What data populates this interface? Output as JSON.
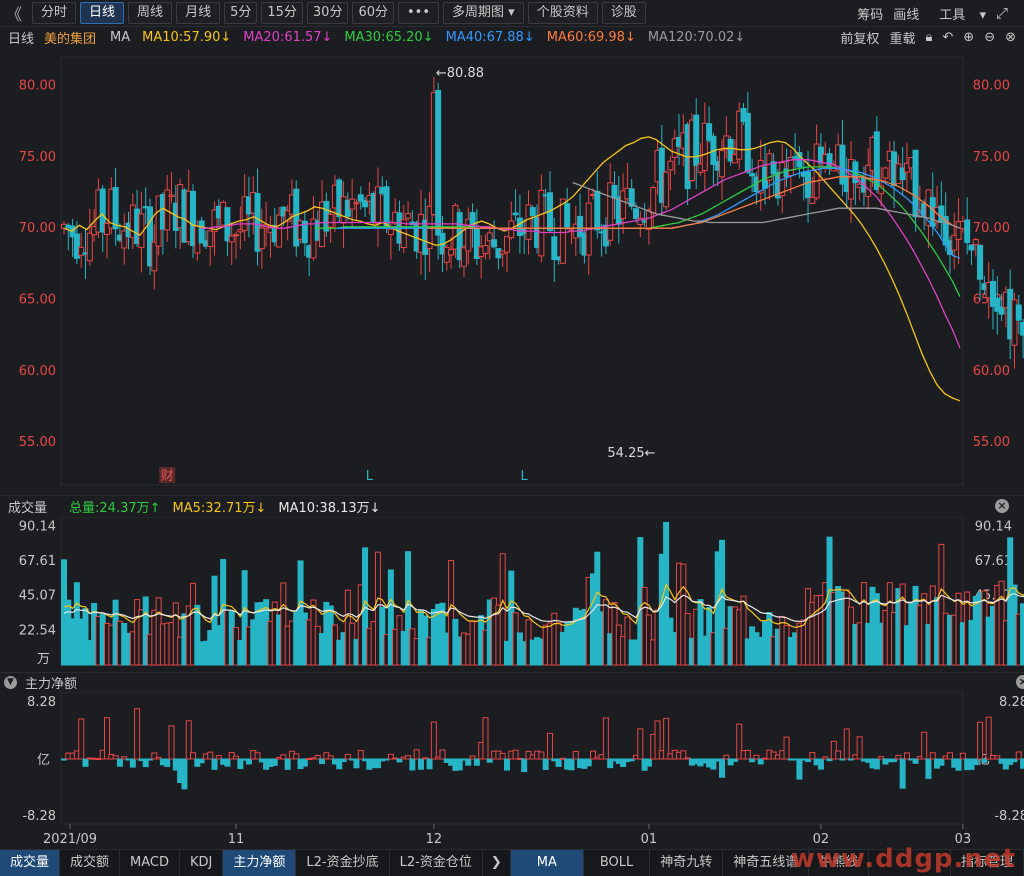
{
  "toolbar": {
    "nav_left": "《",
    "tabs": [
      "分时",
      "日线",
      "周线",
      "月线",
      "5分",
      "15分",
      "30分",
      "60分"
    ],
    "active_tab": "日线",
    "more": "•••",
    "multi_period": "多周期图",
    "stock_info": "个股资料",
    "diagnose": "诊股",
    "right": [
      "筹码",
      "画线",
      "工具"
    ],
    "expand_icon": "expand-icon"
  },
  "ma_bar": {
    "period": "日线",
    "stock": "美的集团",
    "ma_label": "MA",
    "items": [
      {
        "text": "MA10:57.90",
        "arrow": "↓",
        "color": "#f5c518"
      },
      {
        "text": "MA20:61.57",
        "arrow": "↓",
        "color": "#e040c8"
      },
      {
        "text": "MA30:65.20",
        "arrow": "↓",
        "color": "#2ecc40"
      },
      {
        "text": "MA40:67.88",
        "arrow": "↓",
        "color": "#2f9bff"
      },
      {
        "text": "MA60:69.98",
        "arrow": "↓",
        "color": "#ff7b3a"
      },
      {
        "text": "MA120:70.02",
        "arrow": "↓",
        "color": "#9a9a9a"
      }
    ],
    "right": [
      "前复权",
      "重载"
    ]
  },
  "chart_data": [
    {
      "type": "candlestick",
      "name": "price",
      "ylim": [
        52,
        82
      ],
      "yticks": [
        80.0,
        75.0,
        70.0,
        65.0,
        60.0,
        55.0
      ],
      "ytick_labels": [
        "80.00",
        "75.00",
        "70.00",
        "65.00",
        "60.00",
        "55.00"
      ],
      "annotations": [
        {
          "text": "←80.88",
          "value": 80.88,
          "day": 86
        },
        {
          "text": "54.25←",
          "value": 54.25,
          "day": 138
        }
      ],
      "markers": [
        {
          "text": "财",
          "day": 24,
          "color": "#e05050"
        },
        {
          "text": "L",
          "day": 71,
          "color": "#26b5c6"
        },
        {
          "text": "L",
          "day": 107,
          "color": "#26b5c6"
        }
      ],
      "series": [
        {
          "name": "MA10",
          "color": "#f5c518",
          "values": [
            70.0,
            69.8,
            70.2,
            69.9,
            70.5,
            71.0,
            70.4,
            70.2,
            70.1,
            69.8,
            69.5,
            70.2,
            71.0,
            71.4,
            71.1,
            70.8,
            70.6,
            70.2,
            70.1,
            70.0,
            69.9,
            70.1,
            70.3,
            70.5,
            70.6,
            70.8,
            70.5,
            70.2,
            70.1,
            70.4,
            70.8,
            71.0,
            71.2,
            71.5,
            71.4,
            71.2,
            71.0,
            70.8,
            70.6,
            70.5,
            70.3,
            70.2,
            70.4,
            70.1,
            69.8,
            69.6,
            69.4,
            69.2,
            69.0,
            68.8,
            68.9,
            69.2,
            69.6,
            70.0,
            70.3,
            70.5,
            70.3,
            70.0,
            69.8,
            70.0,
            70.3,
            70.6,
            70.8,
            71.0,
            71.2,
            71.5,
            71.8,
            72.2,
            72.8,
            73.4,
            74.0,
            74.6,
            75.0,
            75.4,
            75.8,
            76.0,
            76.3,
            76.4,
            76.2,
            75.8,
            75.4,
            75.2,
            75.0,
            75.0,
            75.1,
            75.3,
            75.5,
            75.6,
            75.6,
            75.5,
            75.5,
            75.6,
            75.8,
            76.0,
            76.1,
            76.0,
            75.6,
            75.0,
            74.5,
            74.0,
            73.4,
            72.8,
            72.2,
            71.6,
            71.0,
            70.3,
            69.5,
            68.6,
            67.6,
            66.5,
            65.3,
            64.0,
            62.6,
            61.2,
            60.0,
            59.0,
            58.4,
            58.1,
            57.9
          ]
        },
        {
          "name": "MA20",
          "color": "#e040c8",
          "values": [
            70.0,
            70.0,
            70.1,
            70.1,
            70.2,
            70.3,
            70.3,
            70.3,
            70.2,
            70.1,
            70.0,
            70.0,
            70.1,
            70.2,
            70.3,
            70.3,
            70.4,
            70.4,
            70.4,
            70.4,
            70.4,
            70.4,
            70.4,
            70.4,
            70.4,
            70.4,
            70.4,
            70.3,
            70.3,
            70.3,
            70.3,
            70.3,
            70.3,
            70.3,
            70.3,
            70.2,
            70.2,
            70.1,
            70.1,
            70.0,
            69.9,
            69.9,
            69.8,
            69.8,
            69.8,
            69.7,
            69.7,
            69.7,
            69.7,
            69.8,
            69.8,
            69.9,
            70.0,
            70.1,
            70.2,
            70.3,
            70.4,
            70.5,
            70.6,
            70.7,
            70.9,
            71.1,
            71.3,
            71.6,
            71.9,
            72.2,
            72.5,
            72.8,
            73.1,
            73.4,
            73.6,
            73.8,
            74.0,
            74.2,
            74.4,
            74.5,
            74.6,
            74.7,
            74.8,
            74.8,
            74.8,
            74.7,
            74.6,
            74.5,
            74.3,
            74.0,
            73.6,
            73.2,
            72.7,
            72.2,
            71.5,
            70.8,
            70.0,
            69.2,
            68.3,
            67.3,
            66.3,
            65.2,
            64.0,
            62.9,
            61.6
          ]
        },
        {
          "name": "MA30",
          "color": "#2ecc40",
          "values": [
            70.0,
            70.0,
            70.0,
            70.0,
            70.1,
            70.1,
            70.1,
            70.1,
            70.1,
            70.1,
            70.1,
            70.1,
            70.1,
            70.1,
            70.1,
            70.1,
            70.1,
            70.1,
            70.1,
            70.1,
            70.1,
            70.0,
            70.0,
            70.0,
            70.0,
            70.0,
            70.0,
            70.0,
            70.0,
            70.0,
            70.0,
            70.0,
            70.0,
            70.0,
            70.0,
            70.0,
            70.0,
            70.0,
            70.0,
            70.0,
            70.0,
            70.0,
            70.0,
            70.0,
            70.0,
            70.1,
            70.2,
            70.3,
            70.4,
            70.6,
            70.8,
            71.0,
            71.3,
            71.6,
            71.9,
            72.2,
            72.5,
            72.8,
            73.1,
            73.4,
            73.6,
            73.8,
            74.0,
            74.1,
            74.2,
            74.3,
            74.3,
            74.3,
            74.3,
            74.2,
            74.1,
            73.9,
            73.7,
            73.4,
            73.1,
            72.7,
            72.2,
            71.7,
            71.1,
            70.4,
            69.7,
            68.9,
            68.1,
            67.2,
            66.3,
            65.2
          ]
        },
        {
          "name": "MA40",
          "color": "#2f9bff",
          "values": [
            70.0,
            70.0,
            70.0,
            70.0,
            70.0,
            70.0,
            70.0,
            70.0,
            70.0,
            70.0,
            70.0,
            70.0,
            70.0,
            70.0,
            70.0,
            70.0,
            70.0,
            70.0,
            70.0,
            70.0,
            70.0,
            70.0,
            70.0,
            70.0,
            70.0,
            70.0,
            70.0,
            70.0,
            70.0,
            70.0,
            70.0,
            70.0,
            70.0,
            70.0,
            70.0,
            70.0,
            70.0,
            70.0,
            70.0,
            70.0,
            70.0,
            70.0,
            70.0,
            70.0,
            70.0,
            70.1,
            70.2,
            70.3,
            70.5,
            70.7,
            70.9,
            71.2,
            71.5,
            71.8,
            72.1,
            72.4,
            72.7,
            73.0,
            73.3,
            73.5,
            73.7,
            73.9,
            74.0,
            74.1,
            74.2,
            74.2,
            74.2,
            74.1,
            74.0,
            73.9,
            73.7,
            73.5,
            73.2,
            72.9,
            72.5,
            72.1,
            71.6,
            71.0,
            70.4,
            69.7,
            68.9,
            68.1,
            67.9
          ]
        },
        {
          "name": "MA60",
          "color": "#ff7b3a",
          "values": [
            70.0,
            70.0,
            70.0,
            70.0,
            70.0,
            70.0,
            70.0,
            70.0,
            70.0,
            70.0,
            70.0,
            70.0,
            70.0,
            70.0,
            70.0,
            70.0,
            70.0,
            70.0,
            70.0,
            70.0,
            70.0,
            70.0,
            70.0,
            70.0,
            70.0,
            70.0,
            70.0,
            70.0,
            70.0,
            70.0,
            70.0,
            70.0,
            70.0,
            70.1,
            70.2,
            70.3,
            70.4,
            70.6,
            70.8,
            71.0,
            71.2,
            71.4,
            71.6,
            71.8,
            72.0,
            72.2,
            72.4,
            72.6,
            72.8,
            73.0,
            73.2,
            73.3,
            73.4,
            73.5,
            73.6,
            73.6,
            73.6,
            73.6,
            73.5,
            73.4,
            73.3,
            73.1,
            72.9,
            72.6,
            72.3,
            71.9,
            71.5,
            71.0,
            70.6,
            70.2,
            70.0
          ]
        },
        {
          "name": "MA120",
          "color": "#9a9a9a",
          "values": [
            73.2,
            73.0,
            72.8,
            72.6,
            72.4,
            72.2,
            72.0,
            71.8,
            71.6,
            71.4,
            71.2,
            71.0,
            70.9,
            70.8,
            70.7,
            70.6,
            70.5,
            70.5,
            70.4,
            70.4,
            70.4,
            70.4,
            70.4,
            70.4,
            70.4,
            70.4,
            70.5,
            70.6,
            70.7,
            70.8,
            70.9,
            71.0,
            71.1,
            71.2,
            71.3,
            71.4,
            71.4,
            71.4,
            71.4,
            71.4,
            71.4,
            71.3,
            71.2,
            71.1,
            71.0,
            70.9,
            70.8,
            70.7,
            70.5,
            70.4,
            70.2,
            70.0
          ]
        }
      ]
    },
    {
      "type": "bar",
      "name": "volume",
      "title": "成交量",
      "legend": [
        {
          "text": "总量:24.37万",
          "arrow": "↑",
          "color": "#2ecc40"
        },
        {
          "text": "MA5:32.71万",
          "arrow": "↓",
          "color": "#f5c518"
        },
        {
          "text": "MA10:38.13万",
          "arrow": "↓",
          "color": "#e8e8e8"
        }
      ],
      "ylim": [
        0,
        95
      ],
      "yticks": [
        90.14,
        67.61,
        45.07,
        22.54
      ],
      "ytick_labels": [
        "90.14",
        "67.61",
        "45.07",
        "22.54"
      ],
      "unit": "万"
    },
    {
      "type": "bar",
      "name": "main_net_flow",
      "title": "主力净额",
      "ylim": [
        -8.28,
        8.28
      ],
      "ytick_labels": [
        "8.28",
        "-8.28"
      ],
      "unit": "亿"
    }
  ],
  "x_axis": {
    "labels": [
      {
        "text": "2021/09",
        "day": 0
      },
      {
        "text": "11",
        "day": 40
      },
      {
        "text": "12",
        "day": 86
      },
      {
        "text": "01",
        "day": 136
      },
      {
        "text": "02",
        "day": 176
      },
      {
        "text": "03",
        "day": 209
      }
    ]
  },
  "bottom_tabs": {
    "left": [
      "成交量",
      "成交额",
      "MACD",
      "KDJ",
      "主力净额",
      "L2-资金抄底",
      "L2-资金仓位"
    ],
    "left_active": [
      "成交量",
      "主力净额"
    ],
    "right": [
      "MA",
      "BOLL",
      "神奇九转",
      "神奇五线谱",
      "牛熊线"
    ],
    "right_active": "MA",
    "last": "指标管理",
    "arrow": "❯"
  },
  "watermark": "www.ddgp.net"
}
